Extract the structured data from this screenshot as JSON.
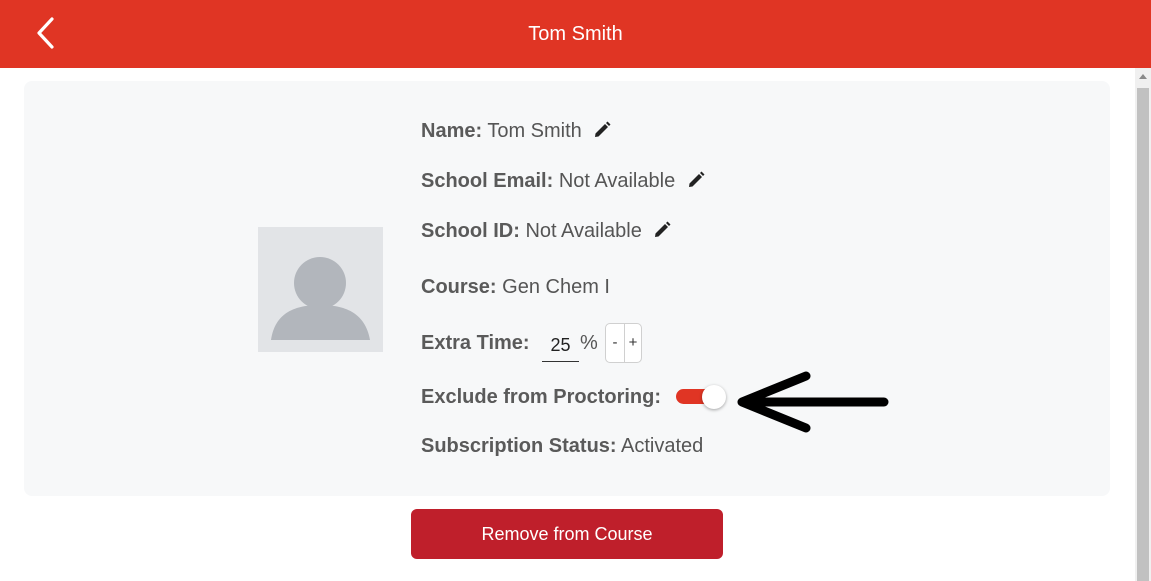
{
  "header": {
    "title": "Tom Smith",
    "back_icon": "chevron-left-icon",
    "background_color": "#e03524"
  },
  "profile": {
    "avatar_icon": "user-placeholder-icon",
    "name_label": "Name:",
    "name_value": "Tom Smith",
    "school_email_label": "School Email:",
    "school_email_value": "Not Available",
    "school_id_label": "School ID:",
    "school_id_value": "Not Available",
    "course_label": "Course:",
    "course_value": "Gen Chem I",
    "extra_time_label": "Extra Time:",
    "extra_time_value": "25",
    "extra_time_unit": "%",
    "stepper_minus": "-",
    "stepper_plus": "+",
    "exclude_label": "Exclude from Proctoring:",
    "exclude_enabled": true,
    "subscription_label": "Subscription Status:",
    "subscription_value": "Activated",
    "edit_icon": "pencil-icon"
  },
  "actions": {
    "remove_label": "Remove from Course",
    "remove_color": "#bf1f2b"
  }
}
